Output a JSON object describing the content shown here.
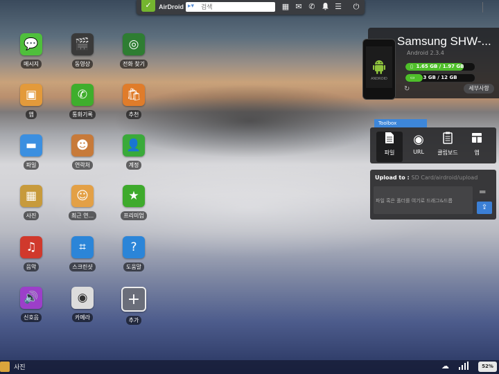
{
  "topbar": {
    "logo_text": "AirDroid",
    "search_placeholder": "검색",
    "icons": [
      "grid-icon",
      "mail-icon",
      "phone-icon",
      "bell-icon",
      "menu-icon",
      "power-icon"
    ]
  },
  "apps": [
    {
      "label": "메시지",
      "icon": "chat-bubble-icon",
      "color": "#4fbf3c"
    },
    {
      "label": "동영상",
      "icon": "clapperboard-icon",
      "color": "#3a3a3a"
    },
    {
      "label": "전화 찾기",
      "icon": "radar-icon",
      "color": "#2e7d32"
    },
    {
      "label": "앱",
      "icon": "package-icon",
      "color": "#e39a3b"
    },
    {
      "label": "통화기록",
      "icon": "phone-icon",
      "color": "#3fae2c"
    },
    {
      "label": "추천",
      "icon": "shopping-bag-icon",
      "color": "#e07c2a"
    },
    {
      "label": "파일",
      "icon": "folder-icon",
      "color": "#3b8fe0"
    },
    {
      "label": "연락처",
      "icon": "contact-book-icon",
      "color": "#c77a3a"
    },
    {
      "label": "계정",
      "icon": "person-icon",
      "color": "#3aaa3a"
    },
    {
      "label": "사진",
      "icon": "picture-icon",
      "color": "#c79a3c"
    },
    {
      "label": "최근 연...",
      "icon": "recent-contacts-icon",
      "color": "#e3a046"
    },
    {
      "label": "프리미엄",
      "icon": "star-icon",
      "color": "#3eaa2c"
    },
    {
      "label": "음악",
      "icon": "music-note-icon",
      "color": "#d0392c"
    },
    {
      "label": "스크린샷",
      "icon": "crop-icon",
      "color": "#2b85d8"
    },
    {
      "label": "도움말",
      "icon": "help-icon",
      "color": "#2b85d8"
    },
    {
      "label": "신호음",
      "icon": "speaker-icon",
      "color": "#9c3fc9"
    },
    {
      "label": "카메라",
      "icon": "camera-icon",
      "color": "#dcdcdc"
    },
    {
      "label": "추가",
      "icon": "plus-icon",
      "color": "#6a6e7a"
    }
  ],
  "device": {
    "name": "Samsung SHW-...",
    "version": "Android 2.3.4",
    "phone_text": "ANDROID",
    "storage1": {
      "text": "1.65 GB / 1.97 GB",
      "fraction": 0.84
    },
    "storage2": {
      "text": "3 GB / 12 GB",
      "fraction": 0.25
    },
    "details_label": "세부사항"
  },
  "toolbox": {
    "tab_label": "Toolbox",
    "tools": [
      {
        "label": "파일",
        "icon": "file-icon"
      },
      {
        "label": "URL",
        "icon": "globe-icon"
      },
      {
        "label": "클립보드",
        "icon": "clipboard-icon"
      },
      {
        "label": "앱",
        "icon": "app-box-icon"
      }
    ],
    "upload_to": "Upload to :",
    "upload_path": "SD Card/airdroid/upload",
    "drop_hint": "파일 혹은 폴더를 여기로 드래그&드롭"
  },
  "taskbar": {
    "active_window": "사진",
    "battery": "52%"
  }
}
